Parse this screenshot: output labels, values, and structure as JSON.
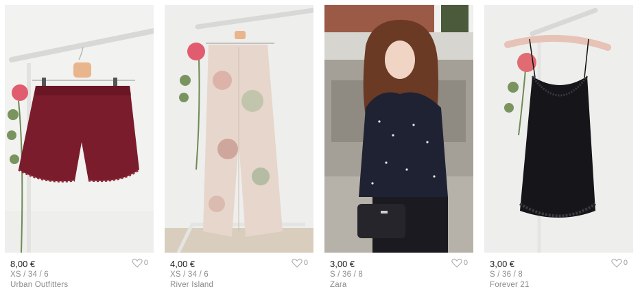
{
  "items": [
    {
      "price": "8,00 €",
      "size": "XS / 34 / 6",
      "brand": "Urban Outfitters",
      "favorites": "0",
      "photo_icon": "burgundy-lace-shorts-photo"
    },
    {
      "price": "4,00 €",
      "size": "XS / 34 / 6",
      "brand": "River Island",
      "favorites": "0",
      "photo_icon": "floral-trousers-photo"
    },
    {
      "price": "3,00 €",
      "size": "S / 36 / 8",
      "brand": "Zara",
      "favorites": "0",
      "photo_icon": "polka-dot-blouse-photo"
    },
    {
      "price": "3,00 €",
      "size": "S / 36 / 8",
      "brand": "Forever 21",
      "favorites": "0",
      "photo_icon": "black-lace-cami-photo"
    }
  ],
  "colors": {
    "price_text": "#222222",
    "meta_text": "#8b8b8b",
    "heart": "#9a9a9a"
  }
}
